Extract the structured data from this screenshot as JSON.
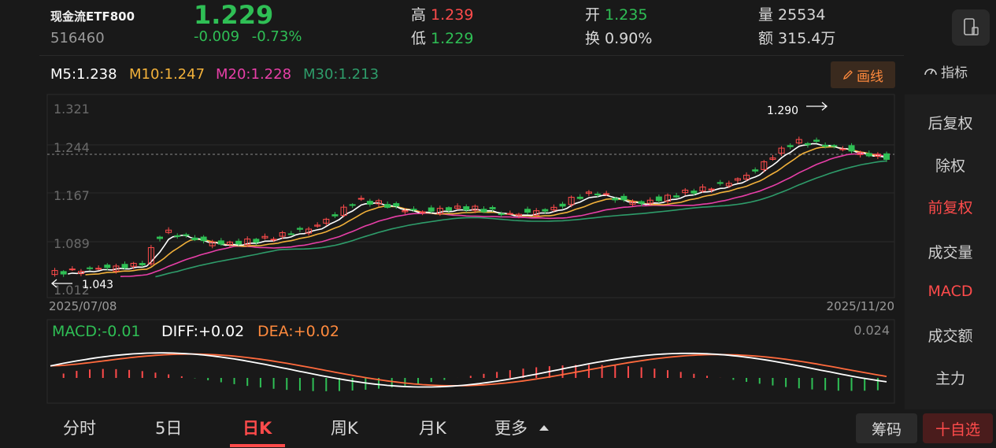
{
  "stock": {
    "name": "现金流ETF800",
    "code": "516460",
    "price": "1.229",
    "change": "-0.009",
    "change_pct": "-0.73%"
  },
  "quote": {
    "high_label": "高",
    "high": "1.239",
    "low_label": "低",
    "low": "1.229",
    "open_label": "开",
    "open": "1.235",
    "turnover_label": "换",
    "turnover": "0.90%",
    "volume_label": "量",
    "volume": "25534",
    "amount_label": "额",
    "amount": "315.4万"
  },
  "ma": {
    "m5": "M5:1.238",
    "m10": "M10:1.247",
    "m20": "M20:1.228",
    "m30": "M30:1.213"
  },
  "toolbar": {
    "draw_label": "画线",
    "indicator_label": "指标"
  },
  "chart_data": {
    "type": "candlestick",
    "y_ticks": [
      "1.321",
      "1.244",
      "1.167",
      "1.089",
      "1.012"
    ],
    "ylim": [
      1.012,
      1.321
    ],
    "start_date": "2025/07/08",
    "end_date": "2025/11/20",
    "max_marker": "1.290",
    "min_marker": "1.043",
    "colors": {
      "up": "#ff4b4b",
      "down": "#2fbf55",
      "m5": "#ffffff",
      "m10": "#f2b13a",
      "m20": "#e83fa8",
      "m30": "#2e9c6a"
    }
  },
  "macd": {
    "macd_label": "MACD:-0.01",
    "diff_label": "DIFF:+0.02",
    "dea_label": "DEA:+0.02",
    "top_value": "0.024"
  },
  "side_menu": [
    "后复权",
    "除权",
    "前复权",
    "成交量",
    "MACD",
    "成交额",
    "主力"
  ],
  "tabs": [
    "分时",
    "5日",
    "日K",
    "周K",
    "月K",
    "更多"
  ],
  "bottom": {
    "chips_label": "筹码",
    "watch_label": "十自选"
  }
}
